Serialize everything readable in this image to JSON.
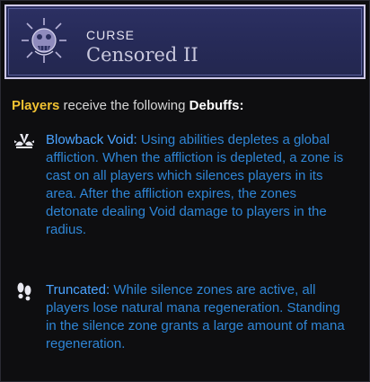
{
  "header": {
    "category": "CURSE",
    "title": "Censored II",
    "icon": "curse-skull-icon"
  },
  "intro": {
    "players": "Players",
    "middle": " receive the following ",
    "debuffs": "Debuffs:"
  },
  "debuffs": [
    {
      "icon": "winged-burst-icon",
      "name": "Blowback Void:",
      "description": " Using abilities depletes a global affliction. When the affliction is depleted, a zone is cast on all players which silences players in its area. After the affliction expires, the zones detonate dealing Void damage to players in the radius."
    },
    {
      "icon": "footprints-icon",
      "name": "Truncated:",
      "description": " While silence zones are active, all players lose natural mana regeneration. Standing in the silence zone grants a large amount of mana regeneration."
    }
  ],
  "colors": {
    "header_bg": "#2a2e5e",
    "header_border": "#cfc9e8",
    "players": "#f1c232",
    "debuff_text": "#2f86d6"
  }
}
